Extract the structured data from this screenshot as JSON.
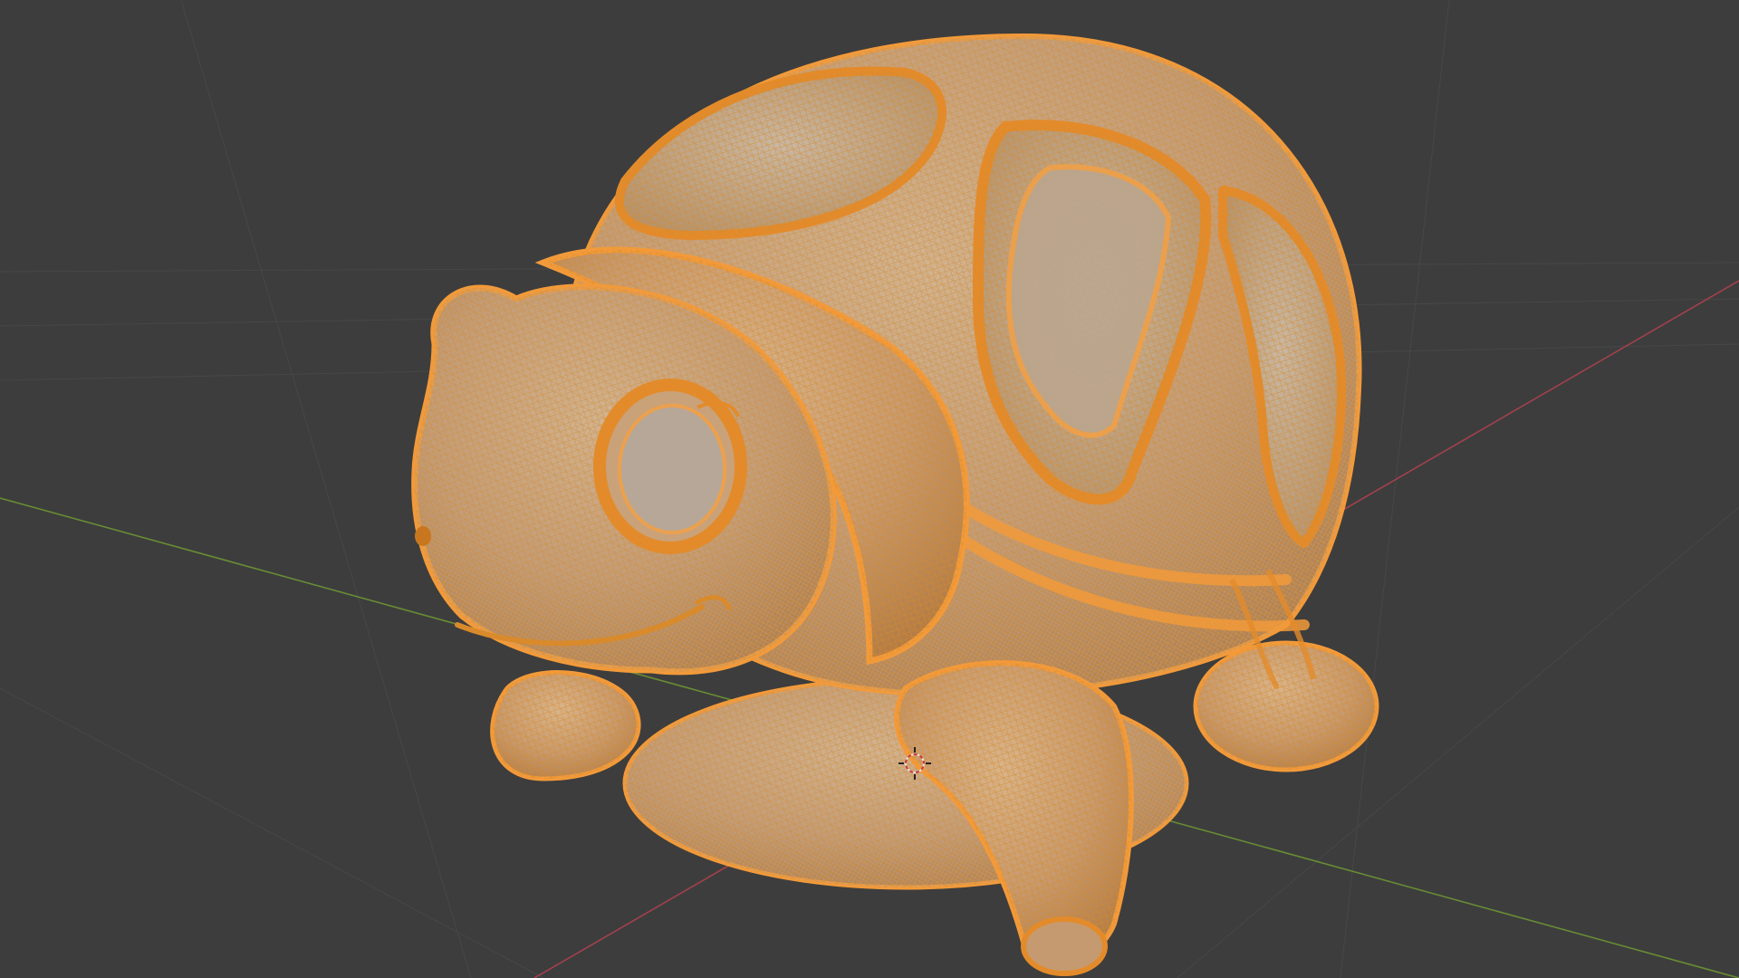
{
  "viewport": {
    "background": "#3d3d3d",
    "grid_line_color": "#474747",
    "x_axis_color": "#b3424f",
    "y_axis_color": "#6f9a33",
    "selection_outline": "#f29a3a",
    "mesh_fill": "#c7a17a",
    "wire_color": "#d98a2b",
    "object": "turtle-mesh",
    "mode": "wireframe-overlay",
    "icons": [
      "3d-cursor-icon"
    ]
  }
}
